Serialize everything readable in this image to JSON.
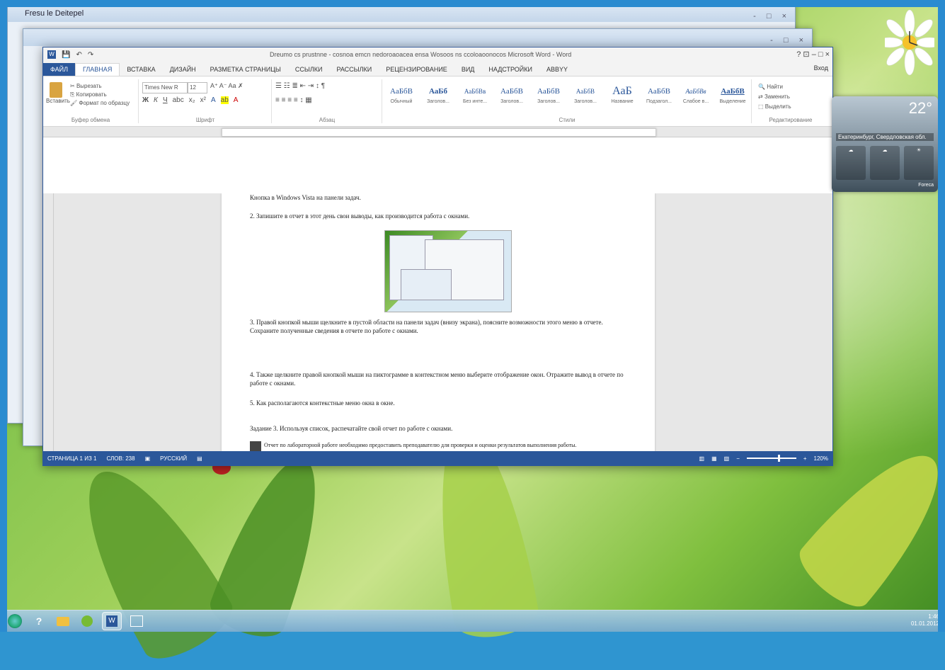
{
  "desktop": {
    "back_window_title": "Fresu le Deitepel",
    "back_window2_title": "",
    "back_window_controls": "- □ ×"
  },
  "word": {
    "title": "Dreumo cs prustnne - cosnoa emcn nedoroaoacea ensa Wosoos ns ccoloaoonocos Microsoft Word - Word",
    "controls": "? ⊡ – □ ×",
    "tabs": [
      "ФАЙЛ",
      "ГЛАВНАЯ",
      "ВСТАВКА",
      "ДИЗАЙН",
      "РАЗМЕТКА СТРАНИЦЫ",
      "ССЫЛКИ",
      "РАССЫЛКИ",
      "РЕЦЕНЗИРОВАНИЕ",
      "ВИД",
      "НАДСТРОЙКИ",
      "ABBYY"
    ],
    "signin": "Вход",
    "ribbon": {
      "clipboard_label": "Буфер обмена",
      "paste": "Вставить",
      "cut": "Вырезать",
      "copy": "Копировать",
      "format_painter": "Формат по образцу",
      "font_label": "Шрифт",
      "font_name": "Times New R",
      "font_size": "12",
      "paragraph_label": "Абзац",
      "styles_label": "Стили",
      "editing_label": "Редактирование",
      "find": "Найти",
      "replace": "Заменить",
      "select": "Выделить",
      "styles": [
        {
          "preview": "АаБбВ",
          "name": "Обычный"
        },
        {
          "preview": "АаБб",
          "name": "Заголов..."
        },
        {
          "preview": "АаБбВв",
          "name": "Без инте..."
        },
        {
          "preview": "АаБбВ",
          "name": "Заголов..."
        },
        {
          "preview": "АаБбВ",
          "name": "Заголов..."
        },
        {
          "preview": "АаБбВ",
          "name": "Заголов..."
        },
        {
          "preview": "АаБ",
          "name": "Название"
        },
        {
          "preview": "АаБбВ",
          "name": "Подзагол..."
        },
        {
          "preview": "АаБбВв",
          "name": "Слабое в..."
        },
        {
          "preview": "АаБбВ",
          "name": "Выделение"
        }
      ]
    },
    "document": {
      "line0": "Кнопка в Windows Vista на панели задач.",
      "item2": "2.   Запишите в отчет в этот день свои выводы, как производится работа с окнами.",
      "item3": "3.   Правой кнопкой мыши щелкните в пустой области на панели задач (внизу экрана), поясните возможности этого меню в отчете. Сохраните полученные сведения в отчете по работе с окнами.",
      "item4": "4.   Также щелкните правой кнопкой мыши на пиктограмме в контекстном меню выберите отображение окон. Отражите вывод в отчете по работе с окнами.",
      "item5": "5.   Как располагаются контекстные меню окна в окне.",
      "task": "Задание 3. Используя список, распечатайте свой отчет по работе с окнами.",
      "note": "Отчет по лабораторной работе необходимо предоставить преподавателю для проверки и оценки результатов выполнения работы."
    },
    "status": {
      "page": "СТРАНИЦА 1 ИЗ 1",
      "words": "СЛОВ: 238",
      "lang": "РУССКИЙ",
      "zoom": "120%"
    }
  },
  "weather": {
    "temp": "22°",
    "city": "Екатеринбург, Свердловская обл.",
    "source": "Foreca"
  },
  "tray": {
    "time": "1:46",
    "date": "01.01.2012"
  }
}
